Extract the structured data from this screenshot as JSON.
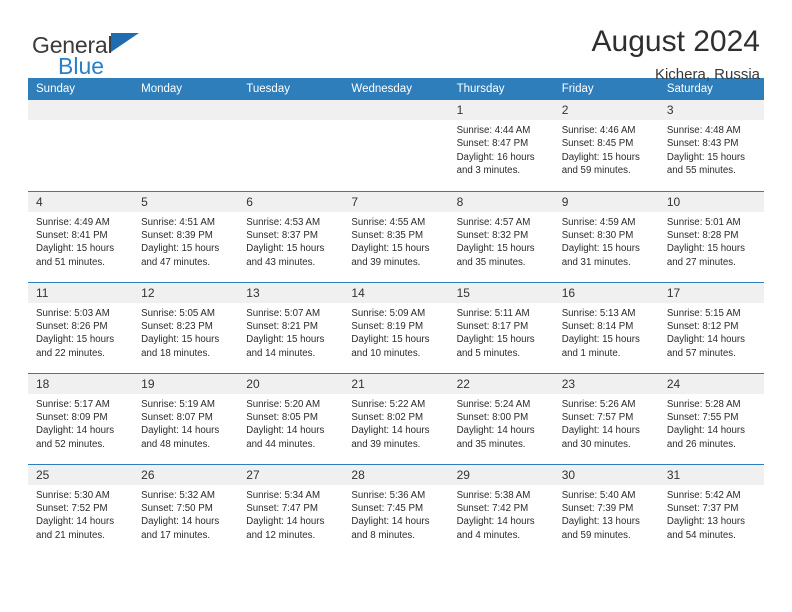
{
  "brand": {
    "line1": "General",
    "line2": "Blue",
    "triangle_color": "#1f6cb0",
    "line2_color": "#2a7fc9"
  },
  "header": {
    "title": "August 2024",
    "subtitle": "Kichera, Russia"
  },
  "theme": {
    "header_blue": "#2e7ebc",
    "daynum_bg": "#f0f0f0",
    "text": "#2b2b2b"
  },
  "weekdays": [
    "Sunday",
    "Monday",
    "Tuesday",
    "Wednesday",
    "Thursday",
    "Friday",
    "Saturday"
  ],
  "weeks": [
    [
      {
        "day": "",
        "lines": []
      },
      {
        "day": "",
        "lines": []
      },
      {
        "day": "",
        "lines": []
      },
      {
        "day": "",
        "lines": []
      },
      {
        "day": "1",
        "lines": [
          "Sunrise: 4:44 AM",
          "Sunset: 8:47 PM",
          "Daylight: 16 hours",
          "and 3 minutes."
        ]
      },
      {
        "day": "2",
        "lines": [
          "Sunrise: 4:46 AM",
          "Sunset: 8:45 PM",
          "Daylight: 15 hours",
          "and 59 minutes."
        ]
      },
      {
        "day": "3",
        "lines": [
          "Sunrise: 4:48 AM",
          "Sunset: 8:43 PM",
          "Daylight: 15 hours",
          "and 55 minutes."
        ]
      }
    ],
    [
      {
        "day": "4",
        "lines": [
          "Sunrise: 4:49 AM",
          "Sunset: 8:41 PM",
          "Daylight: 15 hours",
          "and 51 minutes."
        ]
      },
      {
        "day": "5",
        "lines": [
          "Sunrise: 4:51 AM",
          "Sunset: 8:39 PM",
          "Daylight: 15 hours",
          "and 47 minutes."
        ]
      },
      {
        "day": "6",
        "lines": [
          "Sunrise: 4:53 AM",
          "Sunset: 8:37 PM",
          "Daylight: 15 hours",
          "and 43 minutes."
        ]
      },
      {
        "day": "7",
        "lines": [
          "Sunrise: 4:55 AM",
          "Sunset: 8:35 PM",
          "Daylight: 15 hours",
          "and 39 minutes."
        ]
      },
      {
        "day": "8",
        "lines": [
          "Sunrise: 4:57 AM",
          "Sunset: 8:32 PM",
          "Daylight: 15 hours",
          "and 35 minutes."
        ]
      },
      {
        "day": "9",
        "lines": [
          "Sunrise: 4:59 AM",
          "Sunset: 8:30 PM",
          "Daylight: 15 hours",
          "and 31 minutes."
        ]
      },
      {
        "day": "10",
        "lines": [
          "Sunrise: 5:01 AM",
          "Sunset: 8:28 PM",
          "Daylight: 15 hours",
          "and 27 minutes."
        ]
      }
    ],
    [
      {
        "day": "11",
        "lines": [
          "Sunrise: 5:03 AM",
          "Sunset: 8:26 PM",
          "Daylight: 15 hours",
          "and 22 minutes."
        ]
      },
      {
        "day": "12",
        "lines": [
          "Sunrise: 5:05 AM",
          "Sunset: 8:23 PM",
          "Daylight: 15 hours",
          "and 18 minutes."
        ]
      },
      {
        "day": "13",
        "lines": [
          "Sunrise: 5:07 AM",
          "Sunset: 8:21 PM",
          "Daylight: 15 hours",
          "and 14 minutes."
        ]
      },
      {
        "day": "14",
        "lines": [
          "Sunrise: 5:09 AM",
          "Sunset: 8:19 PM",
          "Daylight: 15 hours",
          "and 10 minutes."
        ]
      },
      {
        "day": "15",
        "lines": [
          "Sunrise: 5:11 AM",
          "Sunset: 8:17 PM",
          "Daylight: 15 hours",
          "and 5 minutes."
        ]
      },
      {
        "day": "16",
        "lines": [
          "Sunrise: 5:13 AM",
          "Sunset: 8:14 PM",
          "Daylight: 15 hours",
          "and 1 minute."
        ]
      },
      {
        "day": "17",
        "lines": [
          "Sunrise: 5:15 AM",
          "Sunset: 8:12 PM",
          "Daylight: 14 hours",
          "and 57 minutes."
        ]
      }
    ],
    [
      {
        "day": "18",
        "lines": [
          "Sunrise: 5:17 AM",
          "Sunset: 8:09 PM",
          "Daylight: 14 hours",
          "and 52 minutes."
        ]
      },
      {
        "day": "19",
        "lines": [
          "Sunrise: 5:19 AM",
          "Sunset: 8:07 PM",
          "Daylight: 14 hours",
          "and 48 minutes."
        ]
      },
      {
        "day": "20",
        "lines": [
          "Sunrise: 5:20 AM",
          "Sunset: 8:05 PM",
          "Daylight: 14 hours",
          "and 44 minutes."
        ]
      },
      {
        "day": "21",
        "lines": [
          "Sunrise: 5:22 AM",
          "Sunset: 8:02 PM",
          "Daylight: 14 hours",
          "and 39 minutes."
        ]
      },
      {
        "day": "22",
        "lines": [
          "Sunrise: 5:24 AM",
          "Sunset: 8:00 PM",
          "Daylight: 14 hours",
          "and 35 minutes."
        ]
      },
      {
        "day": "23",
        "lines": [
          "Sunrise: 5:26 AM",
          "Sunset: 7:57 PM",
          "Daylight: 14 hours",
          "and 30 minutes."
        ]
      },
      {
        "day": "24",
        "lines": [
          "Sunrise: 5:28 AM",
          "Sunset: 7:55 PM",
          "Daylight: 14 hours",
          "and 26 minutes."
        ]
      }
    ],
    [
      {
        "day": "25",
        "lines": [
          "Sunrise: 5:30 AM",
          "Sunset: 7:52 PM",
          "Daylight: 14 hours",
          "and 21 minutes."
        ]
      },
      {
        "day": "26",
        "lines": [
          "Sunrise: 5:32 AM",
          "Sunset: 7:50 PM",
          "Daylight: 14 hours",
          "and 17 minutes."
        ]
      },
      {
        "day": "27",
        "lines": [
          "Sunrise: 5:34 AM",
          "Sunset: 7:47 PM",
          "Daylight: 14 hours",
          "and 12 minutes."
        ]
      },
      {
        "day": "28",
        "lines": [
          "Sunrise: 5:36 AM",
          "Sunset: 7:45 PM",
          "Daylight: 14 hours",
          "and 8 minutes."
        ]
      },
      {
        "day": "29",
        "lines": [
          "Sunrise: 5:38 AM",
          "Sunset: 7:42 PM",
          "Daylight: 14 hours",
          "and 4 minutes."
        ]
      },
      {
        "day": "30",
        "lines": [
          "Sunrise: 5:40 AM",
          "Sunset: 7:39 PM",
          "Daylight: 13 hours",
          "and 59 minutes."
        ]
      },
      {
        "day": "31",
        "lines": [
          "Sunrise: 5:42 AM",
          "Sunset: 7:37 PM",
          "Daylight: 13 hours",
          "and 54 minutes."
        ]
      }
    ]
  ]
}
